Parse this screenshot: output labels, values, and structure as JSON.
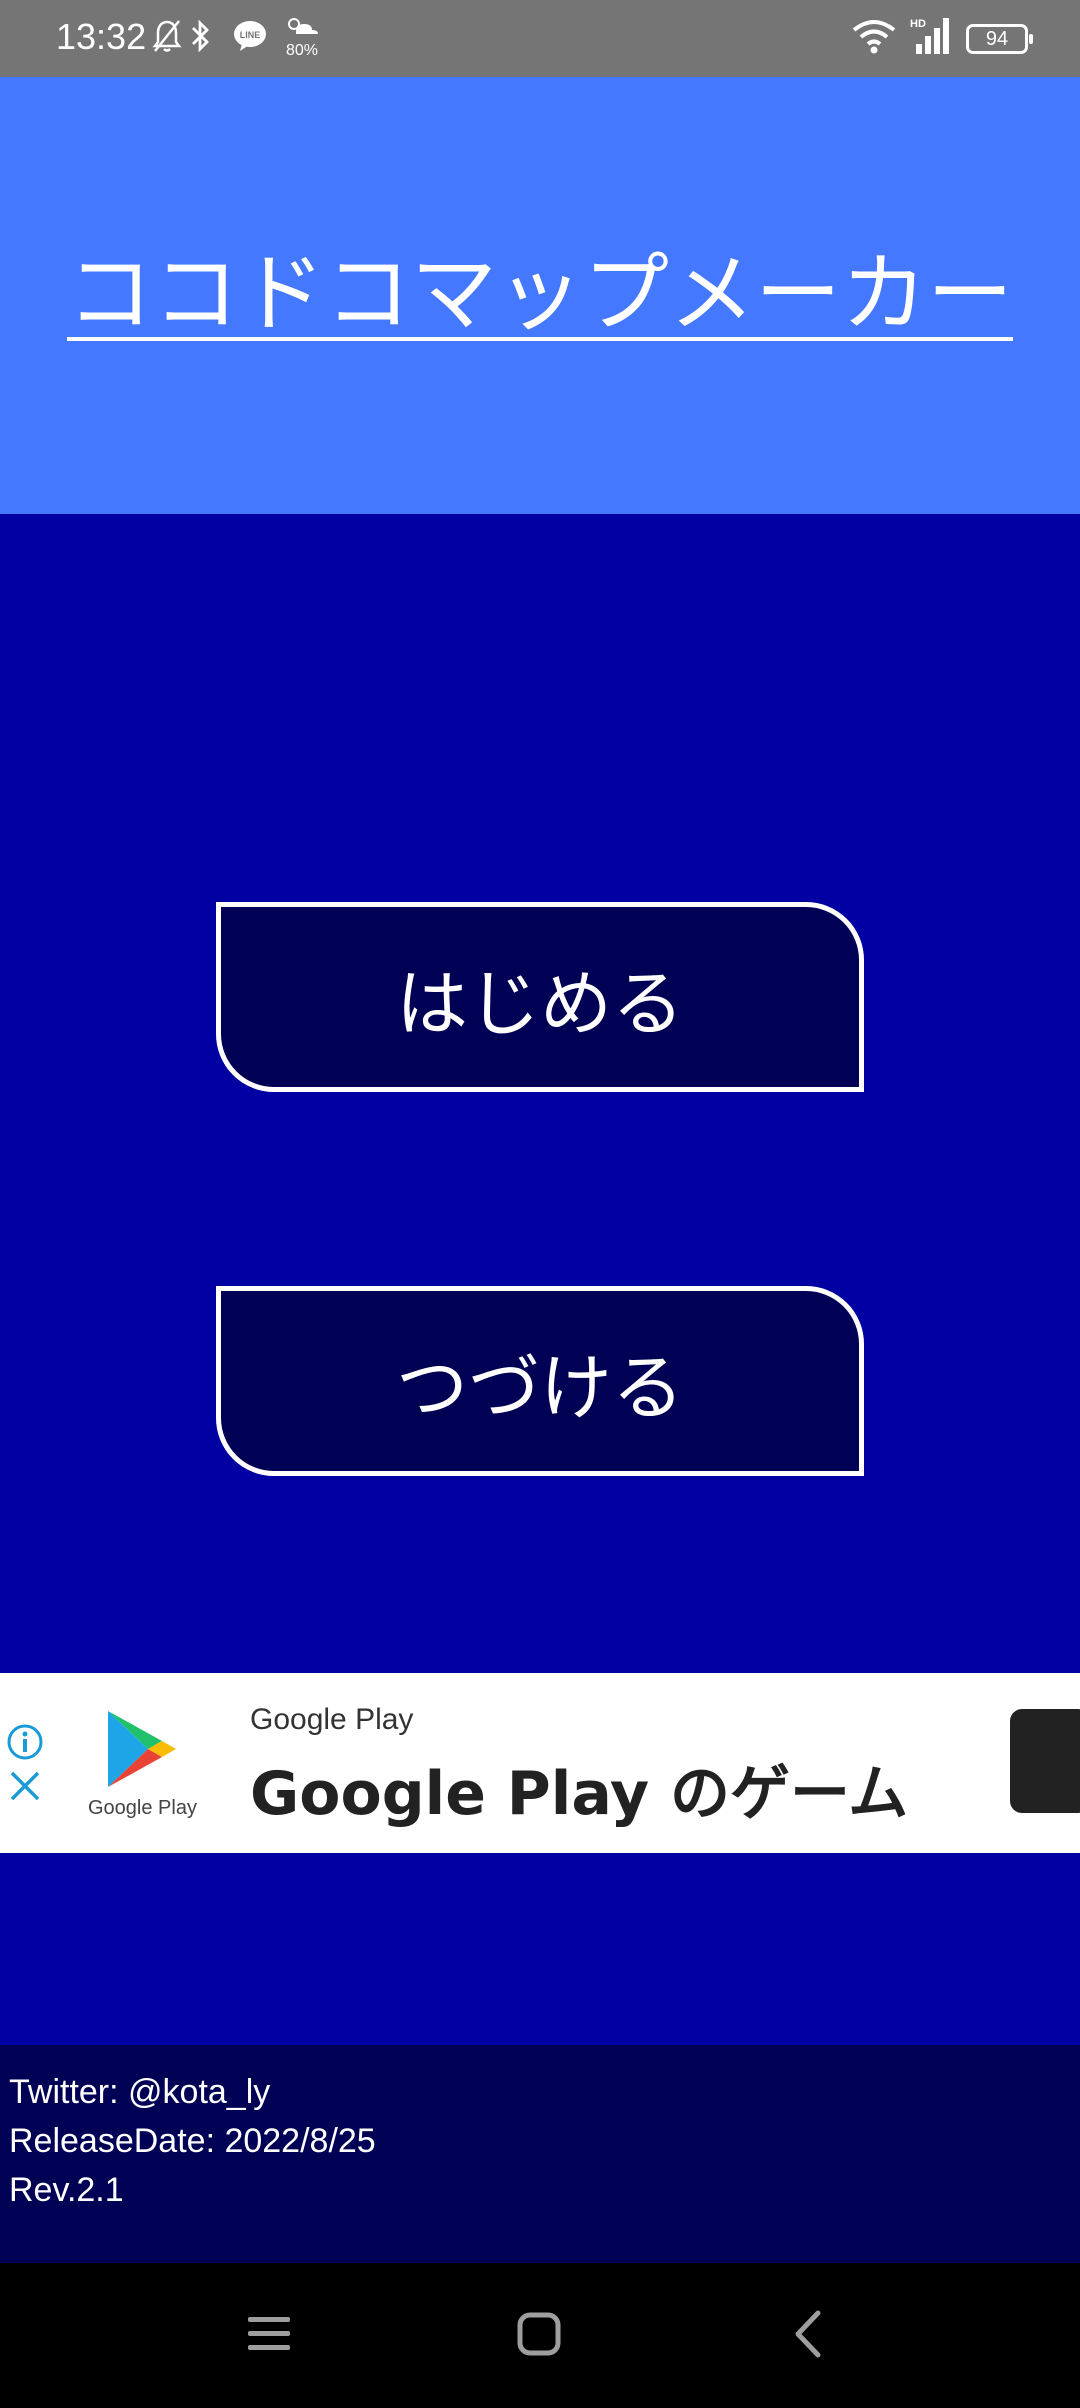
{
  "status_bar": {
    "time": "13:32",
    "weather_text": "80%",
    "battery": "94",
    "icons": [
      "bell-off-icon",
      "bluetooth-icon",
      "line-icon",
      "weather-icon",
      "wifi-icon",
      "signal-icon",
      "battery-icon"
    ]
  },
  "header": {
    "title": "ココドコマップメーカー",
    "color": "#4479ff"
  },
  "menu": {
    "start_label": "はじめる",
    "continue_label": "つづける"
  },
  "ad": {
    "small_text": "Google Play",
    "headline": "Google Play のゲーム",
    "logo_label": "Google Play"
  },
  "footer": {
    "twitter": "Twitter: @kota_ly",
    "release_date": "ReleaseDate: 2022/8/25",
    "revision": "Rev.2.1"
  },
  "colors": {
    "header_bg": "#4479ff",
    "main_bg": "#0000a3",
    "button_bg": "#000055",
    "footer_bg": "#000055"
  }
}
